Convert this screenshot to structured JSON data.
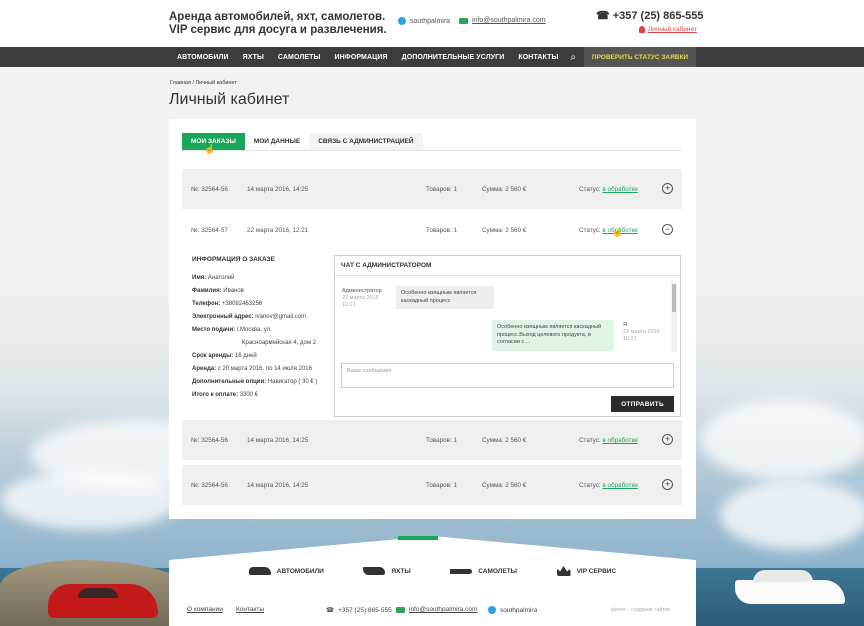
{
  "header": {
    "tagline_1": "Аренда автомобилей, яхт, самолетов.",
    "tagline_2": "VIP сервис для досуга и развлечения.",
    "skype": "southpalmira",
    "email": "info@southpalmira.com",
    "phone": "+357 (25) 865-555",
    "cabinet_link": "Личный кабинет"
  },
  "nav": {
    "items": [
      "АВТОМОБИЛИ",
      "ЯХТЫ",
      "САМОЛЕТЫ",
      "ИНФОРМАЦИЯ",
      "ДОПОЛНИТЕЛЬНЫЕ УСЛУГИ",
      "КОНТАКТЫ"
    ],
    "status_button": "ПРОВЕРИТЬ СТАТУС ЗАЯВКИ"
  },
  "breadcrumb": "Главная / Личный кабинет",
  "page_title": "Личный кабинет",
  "tabs": [
    "МОИ ЗАКАЗЫ",
    "МОИ ДАННЫЕ",
    "СВЯЗЬ С АДМИНИСТРАЦИЕЙ"
  ],
  "orders": [
    {
      "number": "№: 32564-56",
      "date": "14 марта 2016, 14:25",
      "items": "Товаров: 1",
      "sum": "Сумма: 2 560 €",
      "status_label": "Статус:",
      "status": "в обработке"
    },
    {
      "number": "№: 32564-57",
      "date": "22 марта 2016, 12:21",
      "items": "Товаров: 1",
      "sum": "Сумма: 2 560 €",
      "status_label": "Статус:",
      "status": "в обработке"
    },
    {
      "number": "№: 32564-56",
      "date": "14 марта 2016, 14:25",
      "items": "Товаров: 1",
      "sum": "Сумма: 2 560 €",
      "status_label": "Статус:",
      "status": "в обработке"
    },
    {
      "number": "№: 32564-56",
      "date": "14 марта 2016, 14:25",
      "items": "Товаров: 1",
      "sum": "Сумма: 2 560 €",
      "status_label": "Статус:",
      "status": "в обработке"
    }
  ],
  "order_info": {
    "title": "ИНФОРМАЦИЯ О ЗАКАЗЕ",
    "fields": [
      {
        "label": "Имя:",
        "value": "Анатолий"
      },
      {
        "label": "Фамилия:",
        "value": "Иванов"
      },
      {
        "label": "Телефон:",
        "value": "+38092463256"
      },
      {
        "label": "Электронный адрес:",
        "value": "ivanov@gmail.com"
      },
      {
        "label": "Место подачи:",
        "value": "г.Москва, ул."
      },
      {
        "label": "",
        "value": "Красноармейская 4, дом 2"
      },
      {
        "label": "Срок аренды:",
        "value": "16 дней"
      },
      {
        "label": "Аренда:",
        "value": "с 20 марта 2016, по 14 июля 2016"
      },
      {
        "label": "Дополнительные опции:",
        "value": "Навигатор ( 30 € )"
      },
      {
        "label": "Итого к оплате:",
        "value": "3300 €"
      }
    ]
  },
  "chat": {
    "title": "ЧАТ С АДМИНИСТРАТОРОМ",
    "msg1_author": "Администратор",
    "msg1_date": "22 марта 2016",
    "msg1_time": "10:21",
    "msg1_text": "Особенно изящным является каскадный процесс",
    "msg2_author": "Я",
    "msg2_date": "22 марта 2016",
    "msg2_time": "10:21",
    "msg2_text": "Особенно изящным является каскадный процесс.Выход целевого продукта, в согласии с ...",
    "input_placeholder": "Ваше сообщение",
    "send_label": "ОТПРАВИТЬ"
  },
  "footer": {
    "categories": [
      "АВТОМОБИЛИ",
      "ЯХТЫ",
      "САМОЛЕТЫ",
      "VIP СЕРВИС"
    ],
    "about": "О компании",
    "contacts": "Контакты",
    "phone": "+357 (25) 865-555",
    "email": "info@southpalmira.com",
    "skype": "southpalmira",
    "credit": "glavoo – создание сайтов"
  },
  "colors": {
    "accent": "#19a65a",
    "nav": "#3c3c3c",
    "status_button_text": "#e4d94a"
  }
}
